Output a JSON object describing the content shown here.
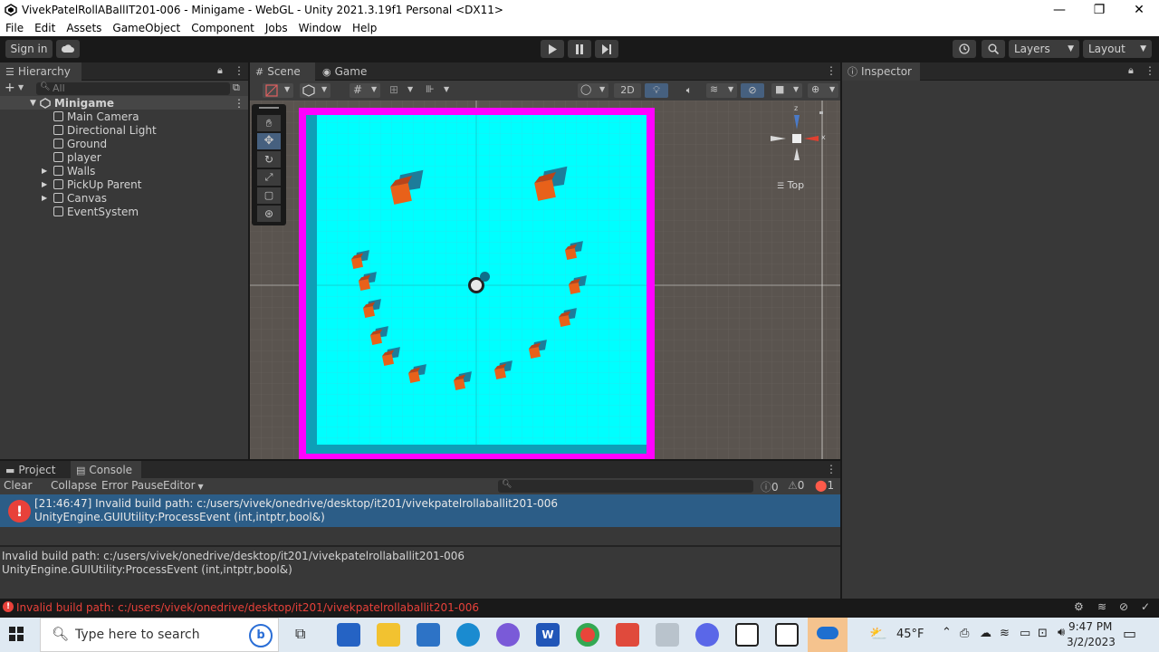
{
  "window": {
    "title": "VivekPatelRollABallIT201-006 - Minigame - WebGL - Unity 2021.3.19f1 Personal <DX11>",
    "minimize": "—",
    "restore": "❐",
    "close": "✕"
  },
  "menu": [
    "File",
    "Edit",
    "Assets",
    "GameObject",
    "Component",
    "Jobs",
    "Window",
    "Help"
  ],
  "toolbar": {
    "sign_in": "Sign in",
    "layers": "Layers",
    "layout": "Layout"
  },
  "hierarchy": {
    "tab": "Hierarchy",
    "search_placeholder": "All",
    "scene_name": "Minigame",
    "items": [
      {
        "label": "Main Camera",
        "expandable": false
      },
      {
        "label": "Directional Light",
        "expandable": false
      },
      {
        "label": "Ground",
        "expandable": false
      },
      {
        "label": "player",
        "expandable": false
      },
      {
        "label": "Walls",
        "expandable": true
      },
      {
        "label": "PickUp Parent",
        "expandable": true
      },
      {
        "label": "Canvas",
        "expandable": true
      },
      {
        "label": "EventSystem",
        "expandable": false
      }
    ]
  },
  "scene_view": {
    "tabs": [
      "Scene",
      "Game"
    ],
    "mode_2d": "2D",
    "gizmo_label": "Top",
    "gizmo_x": "x",
    "gizmo_z": "z",
    "colors": {
      "ground": "#00ffff",
      "wall": "#ff00ff",
      "pickup": "#e8611a",
      "background": "#5a5a5a"
    }
  },
  "inspector": {
    "tab": "Inspector"
  },
  "bottom_panel": {
    "tabs": [
      "Project",
      "Console"
    ],
    "buttons": [
      "Clear",
      "Collapse",
      "Error Pause",
      "Editor"
    ],
    "counts": {
      "log": "0",
      "warning": "0",
      "error": "1"
    },
    "selected_entry": {
      "line1": "[21:46:47] Invalid build path: c:/users/vivek/onedrive/desktop/it201/vivekpatelrollaballit201-006",
      "line2": "UnityEngine.GUIUtility:ProcessEvent (int,intptr,bool&)"
    },
    "detail": {
      "line1": "Invalid build path: c:/users/vivek/onedrive/desktop/it201/vivekpatelrollaballit201-006",
      "line2": "UnityEngine.GUIUtility:ProcessEvent (int,intptr,bool&)"
    }
  },
  "status": {
    "message": "Invalid build path: c:/users/vivek/onedrive/desktop/it201/vivekpatelrollaballit201-006"
  },
  "taskbar": {
    "search_placeholder": "Type here to search",
    "weather": "45°F",
    "time": "9:47 PM",
    "date": "3/2/2023"
  }
}
